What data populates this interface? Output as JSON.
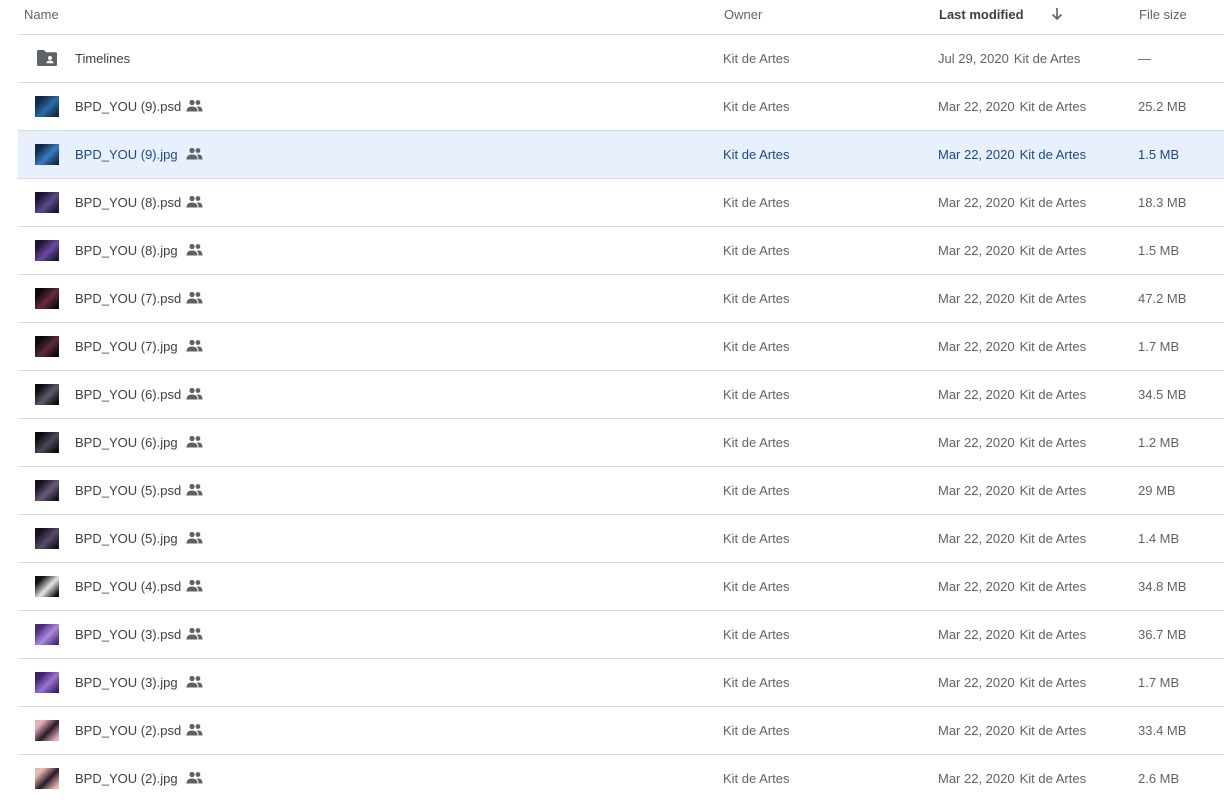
{
  "columns": {
    "name": "Name",
    "owner": "Owner",
    "last_modified": "Last modified",
    "file_size": "File size"
  },
  "sort": {
    "column": "last_modified",
    "direction": "descending",
    "icon": "arrow-down-icon"
  },
  "files": [
    {
      "name": "Timelines",
      "owner": "Kit de Artes",
      "date": "Jul 29, 2020",
      "modified_by": "Kit de Artes",
      "size": "—",
      "type": "folder",
      "shared": false,
      "selected": false
    },
    {
      "name": "BPD_YOU (9).psd",
      "owner": "Kit de Artes",
      "date": "Mar 22, 2020",
      "modified_by": "Kit de Artes",
      "size": "25.2 MB",
      "type": "psd",
      "shared": true,
      "selected": false,
      "thumb": [
        "#0e2a4a",
        "#2e6aa8"
      ]
    },
    {
      "name": "BPD_YOU (9).jpg",
      "owner": "Kit de Artes",
      "date": "Mar 22, 2020",
      "modified_by": "Kit de Artes",
      "size": "1.5 MB",
      "type": "jpg",
      "shared": true,
      "selected": true,
      "thumb": [
        "#0e2a4a",
        "#3a7bc0"
      ]
    },
    {
      "name": "BPD_YOU (8).psd",
      "owner": "Kit de Artes",
      "date": "Mar 22, 2020",
      "modified_by": "Kit de Artes",
      "size": "18.3 MB",
      "type": "psd",
      "shared": true,
      "selected": false,
      "thumb": [
        "#1a1430",
        "#5a4a8a"
      ]
    },
    {
      "name": "BPD_YOU (8).jpg",
      "owner": "Kit de Artes",
      "date": "Mar 22, 2020",
      "modified_by": "Kit de Artes",
      "size": "1.5 MB",
      "type": "jpg",
      "shared": true,
      "selected": false,
      "thumb": [
        "#1c1434",
        "#6a4aa0"
      ]
    },
    {
      "name": "BPD_YOU (7).psd",
      "owner": "Kit de Artes",
      "date": "Mar 22, 2020",
      "modified_by": "Kit de Artes",
      "size": "47.2 MB",
      "type": "psd",
      "shared": true,
      "selected": false,
      "thumb": [
        "#0a0a0e",
        "#6a2a3a"
      ]
    },
    {
      "name": "BPD_YOU (7).jpg",
      "owner": "Kit de Artes",
      "date": "Mar 22, 2020",
      "modified_by": "Kit de Artes",
      "size": "1.7 MB",
      "type": "jpg",
      "shared": true,
      "selected": false,
      "thumb": [
        "#0a0a0e",
        "#5a2a3a"
      ]
    },
    {
      "name": "BPD_YOU (6).psd",
      "owner": "Kit de Artes",
      "date": "Mar 22, 2020",
      "modified_by": "Kit de Artes",
      "size": "34.5 MB",
      "type": "psd",
      "shared": true,
      "selected": false,
      "thumb": [
        "#0c0c10",
        "#5a5a6a"
      ]
    },
    {
      "name": "BPD_YOU (6).jpg",
      "owner": "Kit de Artes",
      "date": "Mar 22, 2020",
      "modified_by": "Kit de Artes",
      "size": "1.2 MB",
      "type": "jpg",
      "shared": true,
      "selected": false,
      "thumb": [
        "#0c0c10",
        "#4a4a5a"
      ]
    },
    {
      "name": "BPD_YOU (5).psd",
      "owner": "Kit de Artes",
      "date": "Mar 22, 2020",
      "modified_by": "Kit de Artes",
      "size": "29 MB",
      "type": "psd",
      "shared": true,
      "selected": false,
      "thumb": [
        "#14121c",
        "#6a5a7a"
      ]
    },
    {
      "name": "BPD_YOU (5).jpg",
      "owner": "Kit de Artes",
      "date": "Mar 22, 2020",
      "modified_by": "Kit de Artes",
      "size": "1.4 MB",
      "type": "jpg",
      "shared": true,
      "selected": false,
      "thumb": [
        "#14121c",
        "#5a4a6a"
      ]
    },
    {
      "name": "BPD_YOU (4).psd",
      "owner": "Kit de Artes",
      "date": "Mar 22, 2020",
      "modified_by": "Kit de Artes",
      "size": "34.8 MB",
      "type": "psd",
      "shared": true,
      "selected": false,
      "thumb": [
        "#111111",
        "#e6e6e6"
      ]
    },
    {
      "name": "BPD_YOU (3).psd",
      "owner": "Kit de Artes",
      "date": "Mar 22, 2020",
      "modified_by": "Kit de Artes",
      "size": "36.7 MB",
      "type": "psd",
      "shared": true,
      "selected": false,
      "thumb": [
        "#4a2a7a",
        "#b08ae0"
      ]
    },
    {
      "name": "BPD_YOU (3).jpg",
      "owner": "Kit de Artes",
      "date": "Mar 22, 2020",
      "modified_by": "Kit de Artes",
      "size": "1.7 MB",
      "type": "jpg",
      "shared": true,
      "selected": false,
      "thumb": [
        "#3a2270",
        "#9a72d0"
      ]
    },
    {
      "name": "BPD_YOU (2).psd",
      "owner": "Kit de Artes",
      "date": "Mar 22, 2020",
      "modified_by": "Kit de Artes",
      "size": "33.4 MB",
      "type": "psd",
      "shared": true,
      "selected": false,
      "thumb": [
        "#e8b0b8",
        "#2a1a2a"
      ]
    },
    {
      "name": "BPD_YOU (2).jpg",
      "owner": "Kit de Artes",
      "date": "Mar 22, 2020",
      "modified_by": "Kit de Artes",
      "size": "2.6 MB",
      "type": "jpg",
      "shared": true,
      "selected": false,
      "thumb": [
        "#e8b8b0",
        "#2a1a2a"
      ]
    }
  ]
}
